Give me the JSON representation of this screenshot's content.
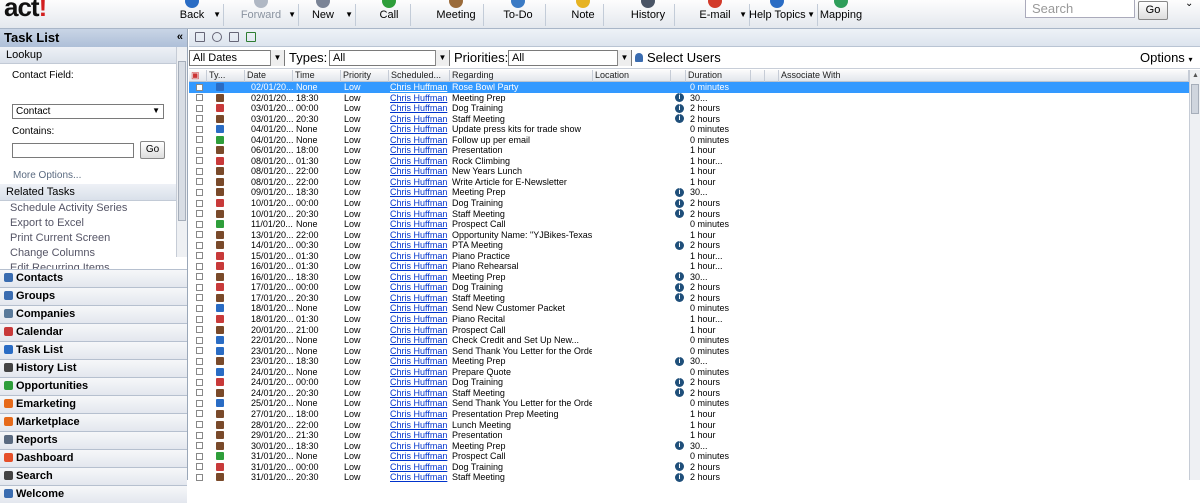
{
  "app": {
    "logo": "act!"
  },
  "toolbar": {
    "buttons": [
      {
        "label": "Back",
        "color": "#2a6cc4"
      },
      {
        "label": "Forward",
        "color": "#b0b8c4"
      },
      {
        "label": "New",
        "color": "#7a8496"
      },
      {
        "label": "Call",
        "color": "#2e9e3a"
      },
      {
        "label": "Meeting",
        "color": "#9a6b3a"
      },
      {
        "label": "To-Do",
        "color": "#3a7ac4"
      },
      {
        "label": "Note",
        "color": "#e6b322"
      },
      {
        "label": "History",
        "color": "#4a5566"
      },
      {
        "label": "E-mail",
        "color": "#d23a2a"
      },
      {
        "label": "Help Topics",
        "color": "#2a6cc4"
      },
      {
        "label": "Mapping",
        "color": "#2e9e5a"
      }
    ],
    "search_placeholder": "Search",
    "go_label": "Go"
  },
  "left": {
    "title": "Task List",
    "collapse": "«",
    "lookup_header": "Lookup",
    "contact_field_label": "Contact Field:",
    "contact_field_value": "Contact",
    "contains_label": "Contains:",
    "go_label": "Go",
    "more_options": "More Options...",
    "related_header": "Related Tasks",
    "related": [
      "Schedule Activity Series",
      "Export to Excel",
      "Print Current Screen",
      "Change Columns",
      "Edit Recurring Items"
    ],
    "nav": [
      {
        "label": "Contacts",
        "color": "#3a6cb0"
      },
      {
        "label": "Groups",
        "color": "#3a6cb0"
      },
      {
        "label": "Companies",
        "color": "#5a7a9a"
      },
      {
        "label": "Calendar",
        "color": "#c83a3a"
      },
      {
        "label": "Task List",
        "color": "#2a6cc4"
      },
      {
        "label": "History List",
        "color": "#444"
      },
      {
        "label": "Opportunities",
        "color": "#2e9e3a"
      },
      {
        "label": "Emarketing",
        "color": "#e66a1a"
      },
      {
        "label": "Marketplace",
        "color": "#e66a1a"
      },
      {
        "label": "Reports",
        "color": "#5a6a80"
      },
      {
        "label": "Dashboard",
        "color": "#e6502a"
      },
      {
        "label": "Search",
        "color": "#444"
      },
      {
        "label": "Welcome",
        "color": "#3a6cb0"
      }
    ]
  },
  "filters": {
    "dates": "All Dates",
    "types_label": "Types:",
    "types": "All",
    "priorities_label": "Priorities:",
    "priorities": "All",
    "select_users": "Select Users",
    "options": "Options"
  },
  "columns": {
    "ty": "Ty...",
    "date": "Date",
    "time": "Time",
    "priority": "Priority",
    "scheduled": "Scheduled...",
    "regarding": "Regarding",
    "location": "Location",
    "duration": "Duration",
    "associate": "Associate With"
  },
  "type_colors": {
    "todo": "#2a6cc4",
    "meeting": "#7a4a2a",
    "call": "#2e9e3a",
    "calendar": "#c83a3a"
  },
  "rows": [
    {
      "type": "todo",
      "date": "02/01/20...",
      "time": "None",
      "priority": "Low",
      "scheduled": "Chris Huffman",
      "regarding": "Rose Bowl Party",
      "info": false,
      "duration": "0 minutes",
      "selected": true
    },
    {
      "type": "meeting",
      "date": "02/01/20...",
      "time": "18:30",
      "priority": "Low",
      "scheduled": "Chris Huffman",
      "regarding": "Meeting Prep",
      "info": true,
      "duration": "30..."
    },
    {
      "type": "calendar",
      "date": "03/01/20...",
      "time": "00:00",
      "priority": "Low",
      "scheduled": "Chris Huffman",
      "regarding": "Dog Training",
      "info": true,
      "duration": "2 hours"
    },
    {
      "type": "meeting",
      "date": "03/01/20...",
      "time": "20:30",
      "priority": "Low",
      "scheduled": "Chris Huffman",
      "regarding": "Staff Meeting",
      "info": true,
      "duration": "2 hours"
    },
    {
      "type": "todo",
      "date": "04/01/20...",
      "time": "None",
      "priority": "Low",
      "scheduled": "Chris Huffman",
      "regarding": "Update press kits for trade show",
      "info": false,
      "duration": "0 minutes"
    },
    {
      "type": "call",
      "date": "04/01/20...",
      "time": "None",
      "priority": "Low",
      "scheduled": "Chris Huffman",
      "regarding": "Follow up per email",
      "info": false,
      "duration": "0 minutes"
    },
    {
      "type": "meeting",
      "date": "06/01/20...",
      "time": "18:00",
      "priority": "Low",
      "scheduled": "Chris Huffman",
      "regarding": "Presentation",
      "info": false,
      "duration": "1 hour"
    },
    {
      "type": "calendar",
      "date": "08/01/20...",
      "time": "01:30",
      "priority": "Low",
      "scheduled": "Chris Huffman",
      "regarding": "Rock Climbing",
      "info": false,
      "duration": "1 hour..."
    },
    {
      "type": "meeting",
      "date": "08/01/20...",
      "time": "22:00",
      "priority": "Low",
      "scheduled": "Chris Huffman",
      "regarding": "New Years Lunch",
      "info": false,
      "duration": "1 hour"
    },
    {
      "type": "meeting",
      "date": "08/01/20...",
      "time": "22:00",
      "priority": "Low",
      "scheduled": "Chris Huffman",
      "regarding": "Write Article for E-Newsletter",
      "info": false,
      "duration": "1 hour"
    },
    {
      "type": "meeting",
      "date": "09/01/20...",
      "time": "18:30",
      "priority": "Low",
      "scheduled": "Chris Huffman",
      "regarding": "Meeting Prep",
      "info": true,
      "duration": "30..."
    },
    {
      "type": "calendar",
      "date": "10/01/20...",
      "time": "00:00",
      "priority": "Low",
      "scheduled": "Chris Huffman",
      "regarding": "Dog Training",
      "info": true,
      "duration": "2 hours"
    },
    {
      "type": "meeting",
      "date": "10/01/20...",
      "time": "20:30",
      "priority": "Low",
      "scheduled": "Chris Huffman",
      "regarding": "Staff Meeting",
      "info": true,
      "duration": "2 hours"
    },
    {
      "type": "call",
      "date": "11/01/20...",
      "time": "None",
      "priority": "Low",
      "scheduled": "Chris Huffman",
      "regarding": "Prospect Call",
      "info": false,
      "duration": "0 minutes"
    },
    {
      "type": "meeting",
      "date": "13/01/20...",
      "time": "22:00",
      "priority": "Low",
      "scheduled": "Chris Huffman",
      "regarding": "Opportunity  Name:  \"YJBikes-Texas...",
      "info": false,
      "duration": "1 hour"
    },
    {
      "type": "meeting",
      "date": "14/01/20...",
      "time": "00:30",
      "priority": "Low",
      "scheduled": "Chris Huffman",
      "regarding": "PTA Meeting",
      "info": true,
      "duration": "2 hours"
    },
    {
      "type": "calendar",
      "date": "15/01/20...",
      "time": "01:30",
      "priority": "Low",
      "scheduled": "Chris Huffman",
      "regarding": "Piano Practice",
      "info": false,
      "duration": "1 hour..."
    },
    {
      "type": "calendar",
      "date": "16/01/20...",
      "time": "01:30",
      "priority": "Low",
      "scheduled": "Chris Huffman",
      "regarding": "Piano Rehearsal",
      "info": false,
      "duration": "1 hour..."
    },
    {
      "type": "meeting",
      "date": "16/01/20...",
      "time": "18:30",
      "priority": "Low",
      "scheduled": "Chris Huffman",
      "regarding": "Meeting Prep",
      "info": true,
      "duration": "30..."
    },
    {
      "type": "calendar",
      "date": "17/01/20...",
      "time": "00:00",
      "priority": "Low",
      "scheduled": "Chris Huffman",
      "regarding": "Dog Training",
      "info": true,
      "duration": "2 hours"
    },
    {
      "type": "meeting",
      "date": "17/01/20...",
      "time": "20:30",
      "priority": "Low",
      "scheduled": "Chris Huffman",
      "regarding": "Staff Meeting",
      "info": true,
      "duration": "2 hours"
    },
    {
      "type": "todo",
      "date": "18/01/20...",
      "time": "None",
      "priority": "Low",
      "scheduled": "Chris Huffman",
      "regarding": "Send New Customer Packet",
      "info": false,
      "duration": "0 minutes"
    },
    {
      "type": "calendar",
      "date": "18/01/20...",
      "time": "01:30",
      "priority": "Low",
      "scheduled": "Chris Huffman",
      "regarding": "Piano Recital",
      "info": false,
      "duration": "1 hour..."
    },
    {
      "type": "meeting",
      "date": "20/01/20...",
      "time": "21:00",
      "priority": "Low",
      "scheduled": "Chris Huffman",
      "regarding": "Prospect Call",
      "info": false,
      "duration": "1 hour"
    },
    {
      "type": "todo",
      "date": "22/01/20...",
      "time": "None",
      "priority": "Low",
      "scheduled": "Chris Huffman",
      "regarding": "Check  Credit  and  Set  Up  New...",
      "info": false,
      "duration": "0 minutes"
    },
    {
      "type": "todo",
      "date": "23/01/20...",
      "time": "None",
      "priority": "Low",
      "scheduled": "Chris Huffman",
      "regarding": "Send Thank You Letter for the Order",
      "info": false,
      "duration": "0 minutes"
    },
    {
      "type": "meeting",
      "date": "23/01/20...",
      "time": "18:30",
      "priority": "Low",
      "scheduled": "Chris Huffman",
      "regarding": "Meeting Prep",
      "info": true,
      "duration": "30..."
    },
    {
      "type": "todo",
      "date": "24/01/20...",
      "time": "None",
      "priority": "Low",
      "scheduled": "Chris Huffman",
      "regarding": "Prepare Quote",
      "info": false,
      "duration": "0 minutes"
    },
    {
      "type": "calendar",
      "date": "24/01/20...",
      "time": "00:00",
      "priority": "Low",
      "scheduled": "Chris Huffman",
      "regarding": "Dog Training",
      "info": true,
      "duration": "2 hours"
    },
    {
      "type": "meeting",
      "date": "24/01/20...",
      "time": "20:30",
      "priority": "Low",
      "scheduled": "Chris Huffman",
      "regarding": "Staff Meeting",
      "info": true,
      "duration": "2 hours"
    },
    {
      "type": "todo",
      "date": "25/01/20...",
      "time": "None",
      "priority": "Low",
      "scheduled": "Chris Huffman",
      "regarding": "Send Thank You Letter for the Order",
      "info": false,
      "duration": "0 minutes"
    },
    {
      "type": "meeting",
      "date": "27/01/20...",
      "time": "18:00",
      "priority": "Low",
      "scheduled": "Chris Huffman",
      "regarding": "Presentation Prep Meeting",
      "info": false,
      "duration": "1 hour"
    },
    {
      "type": "meeting",
      "date": "28/01/20...",
      "time": "22:00",
      "priority": "Low",
      "scheduled": "Chris Huffman",
      "regarding": "Lunch Meeting",
      "info": false,
      "duration": "1 hour"
    },
    {
      "type": "meeting",
      "date": "29/01/20...",
      "time": "21:30",
      "priority": "Low",
      "scheduled": "Chris Huffman",
      "regarding": "Presentation",
      "info": false,
      "duration": "1 hour"
    },
    {
      "type": "meeting",
      "date": "30/01/20...",
      "time": "18:30",
      "priority": "Low",
      "scheduled": "Chris Huffman",
      "regarding": "Meeting Prep",
      "info": true,
      "duration": "30..."
    },
    {
      "type": "call",
      "date": "31/01/20...",
      "time": "None",
      "priority": "Low",
      "scheduled": "Chris Huffman",
      "regarding": "Prospect Call",
      "info": false,
      "duration": "0 minutes"
    },
    {
      "type": "calendar",
      "date": "31/01/20...",
      "time": "00:00",
      "priority": "Low",
      "scheduled": "Chris Huffman",
      "regarding": "Dog Training",
      "info": true,
      "duration": "2 hours"
    },
    {
      "type": "meeting",
      "date": "31/01/20...",
      "time": "20:30",
      "priority": "Low",
      "scheduled": "Chris Huffman",
      "regarding": "Staff Meeting",
      "info": true,
      "duration": "2 hours"
    }
  ]
}
